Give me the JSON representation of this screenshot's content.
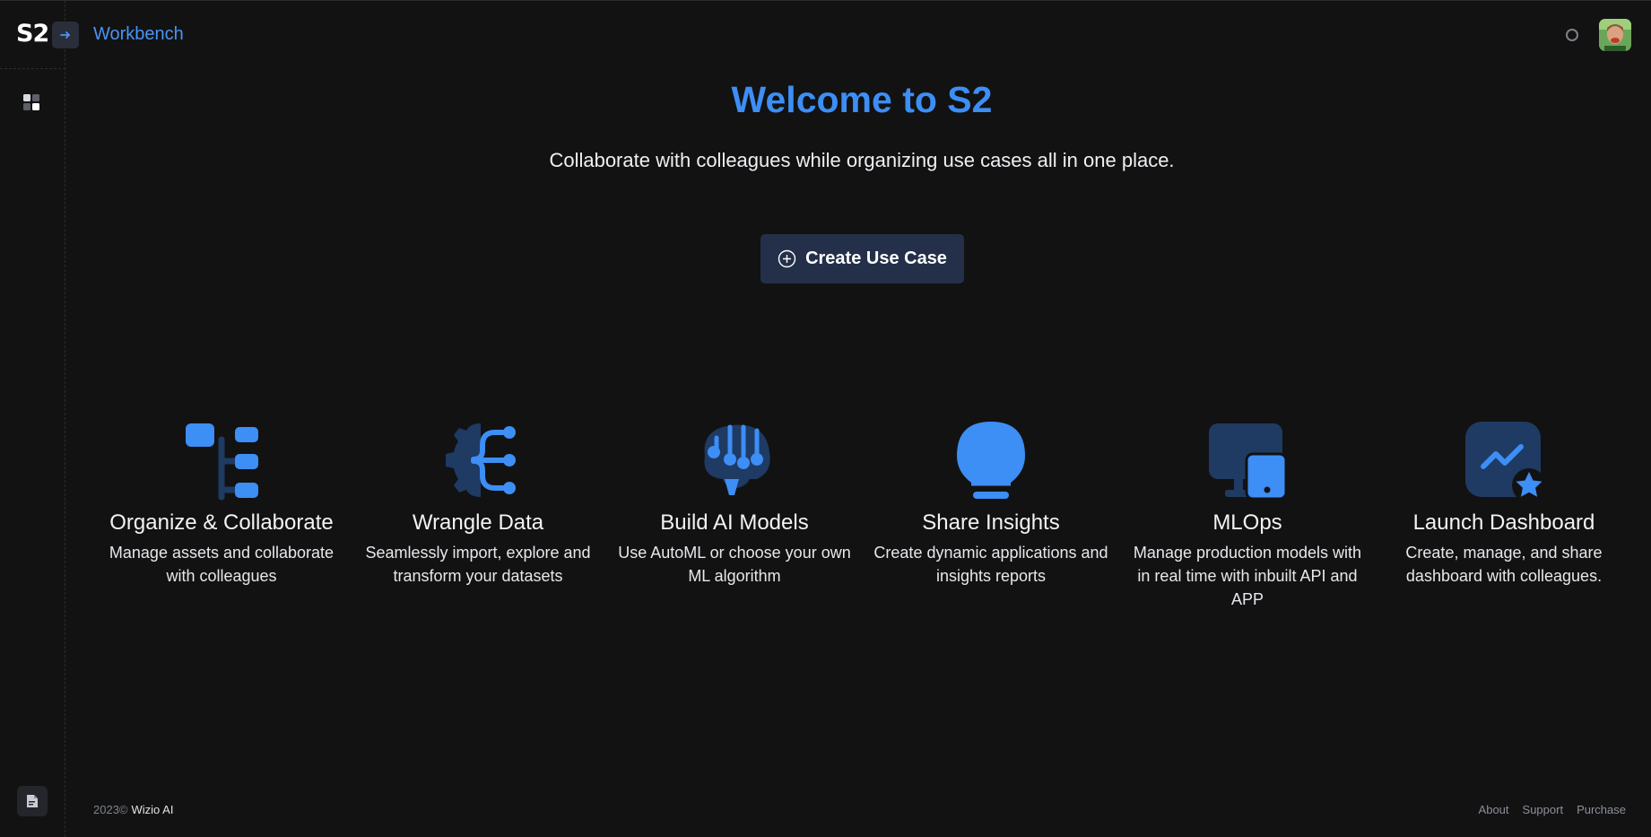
{
  "header": {
    "logo": "S2",
    "app_title": "Workbench"
  },
  "hero": {
    "title": "Welcome to S2",
    "subtitle": "Collaborate with colleagues while organizing use cases all in one place.",
    "create_button_label": "Create Use Case"
  },
  "features": [
    {
      "icon": "hierarchy-icon",
      "title": "Organize & Collaborate",
      "description": "Manage assets and collaborate with colleagues"
    },
    {
      "icon": "gear-network-icon",
      "title": "Wrangle Data",
      "description": "Seamlessly import, explore and transform your datasets"
    },
    {
      "icon": "brain-circuit-icon",
      "title": "Build AI Models",
      "description": "Use AutoML or choose your own ML algorithm"
    },
    {
      "icon": "lightbulb-icon",
      "title": "Share Insights",
      "description": "Create dynamic applications and insights reports"
    },
    {
      "icon": "monitor-mobile-icon",
      "title": "MLOps",
      "description": "Manage production models with in real time with inbuilt API and APP"
    },
    {
      "icon": "dashboard-star-icon",
      "title": "Launch Dashboard",
      "description": "Create, manage, and share dashboard with colleagues."
    }
  ],
  "footer": {
    "copyright": "2023©",
    "company": "Wizio AI",
    "links": [
      "About",
      "Support",
      "Purchase"
    ]
  },
  "colors": {
    "accent": "#3d8ef5",
    "icon_dark": "#1f3a63",
    "background": "#121213",
    "button_bg": "#243049"
  }
}
